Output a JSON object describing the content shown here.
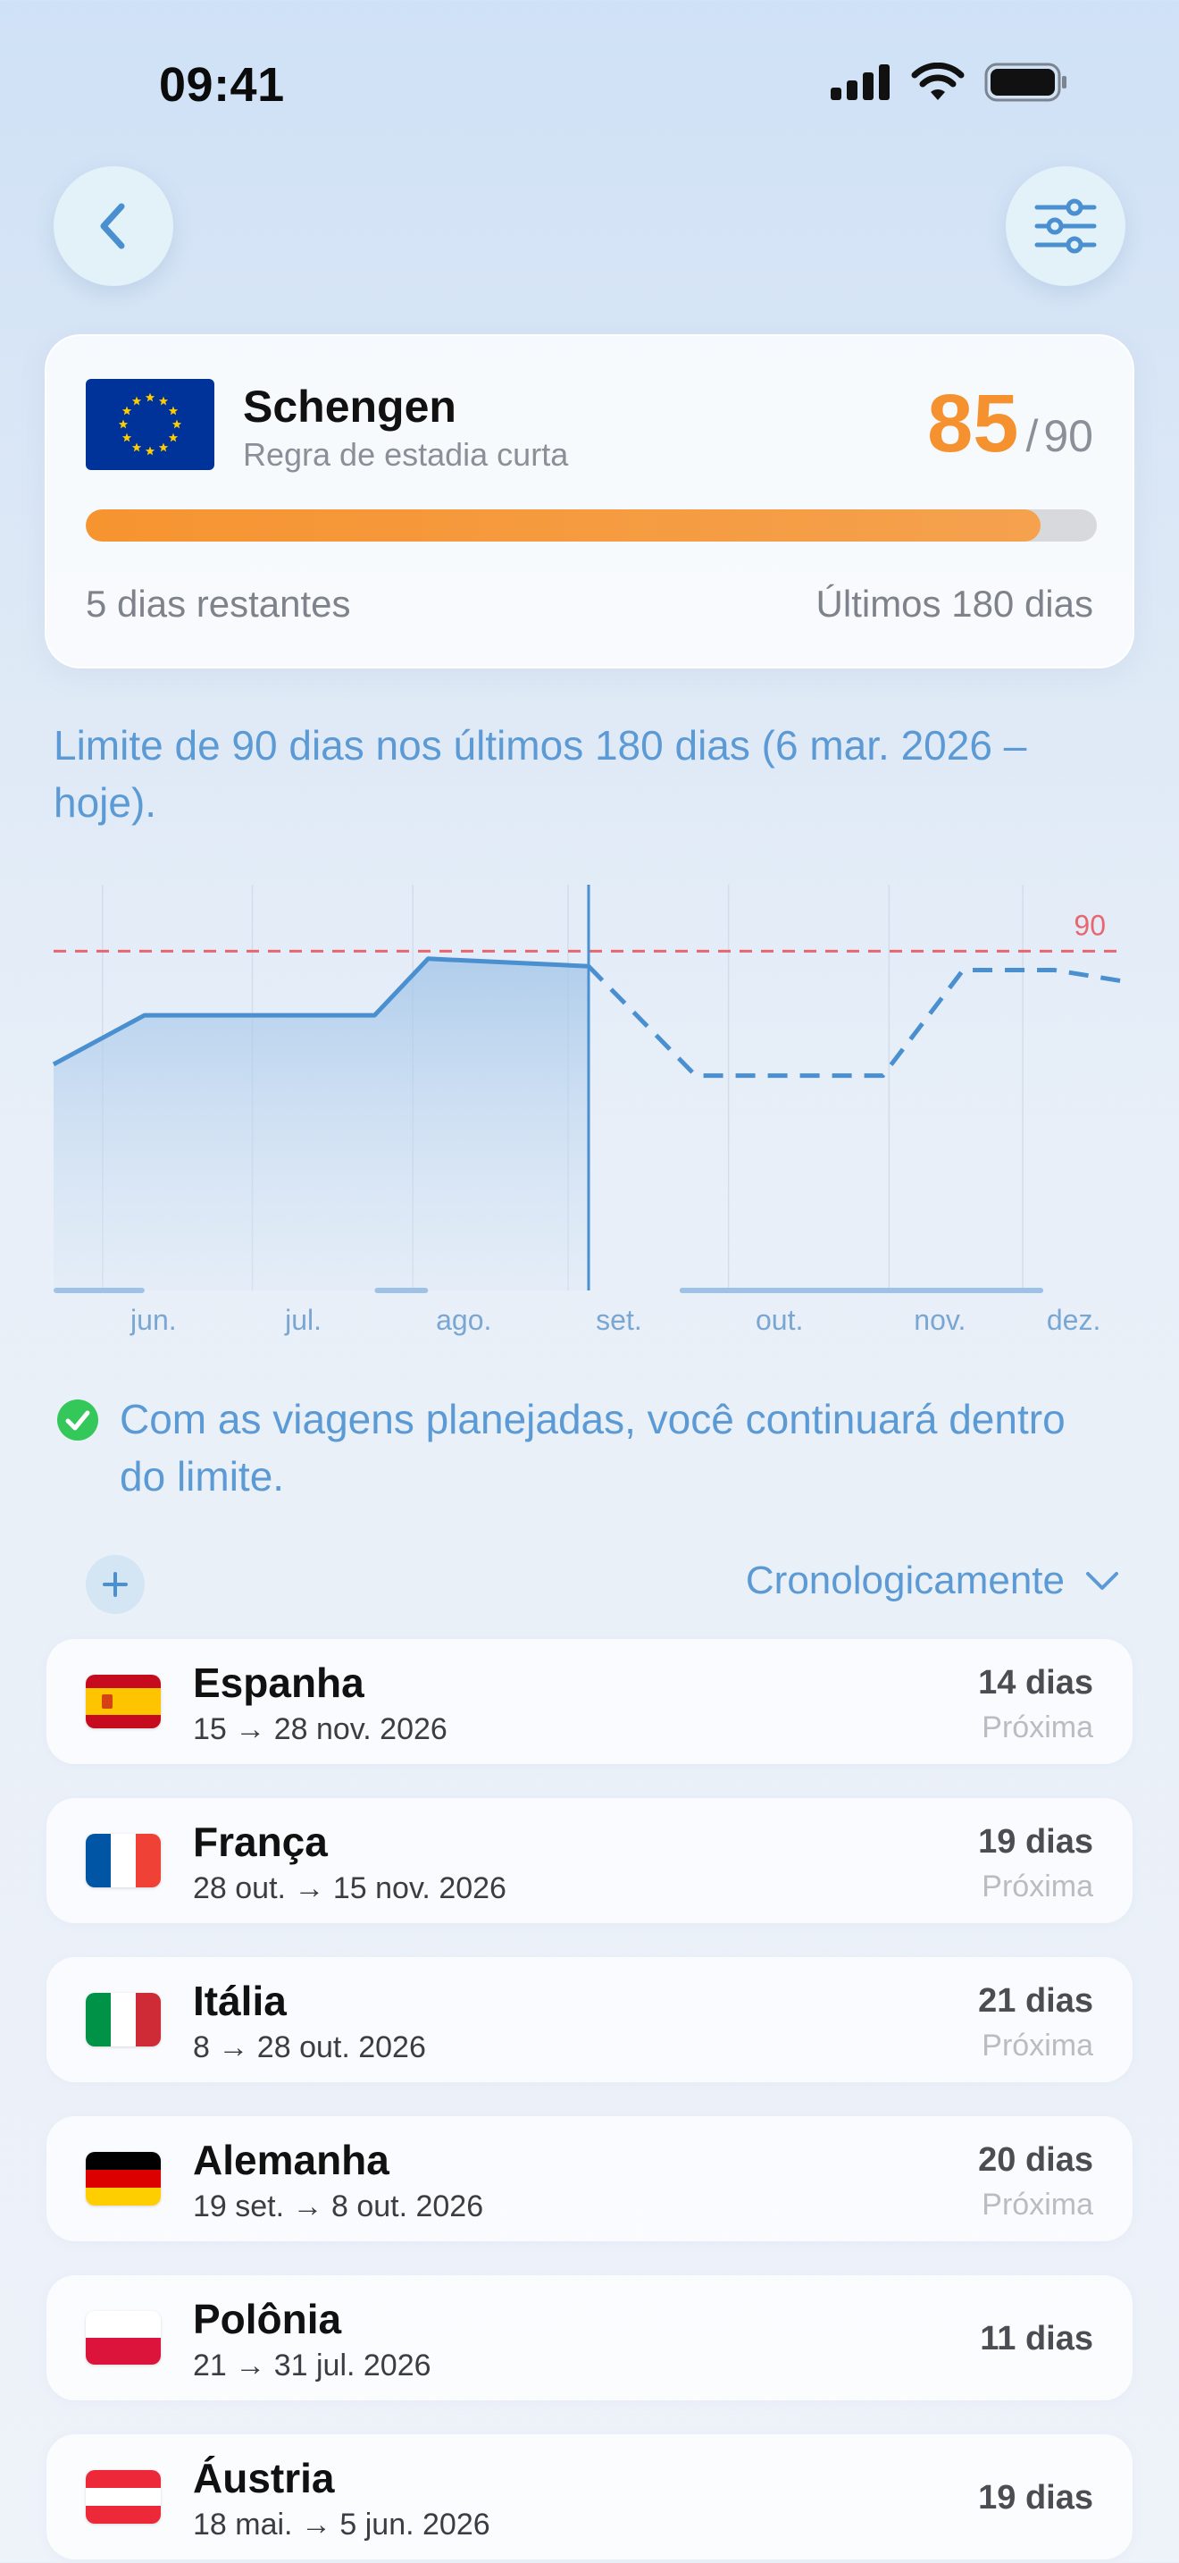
{
  "status_bar": {
    "time": "09:41"
  },
  "summary": {
    "region": "Schengen",
    "subtitle": "Regra de estadia curta",
    "used": "85",
    "slash": "/",
    "max": "90",
    "progress_fraction": 0.944,
    "remaining": "5 dias restantes",
    "window": "Últimos 180 dias"
  },
  "description": "Limite de 90 dias nos últimos 180 dias (6 mar. 2026 – hoje).",
  "chart_data": {
    "type": "area",
    "limit": 90,
    "limit_label": "90",
    "months": [
      "jun.",
      "jul.",
      "ago.",
      "set.",
      "out.",
      "nov.",
      "dez."
    ],
    "x_range": [
      0,
      200
    ],
    "y_range": [
      0,
      110
    ],
    "today_x": 100,
    "actual": {
      "x": [
        0,
        17,
        60,
        70,
        100
      ],
      "y": [
        60,
        73,
        73,
        88,
        86
      ]
    },
    "projected": {
      "x": [
        100,
        120,
        155,
        170,
        187,
        200
      ],
      "y": [
        86,
        57,
        57,
        85,
        85,
        82
      ]
    },
    "trip_bars": [
      {
        "start": 0,
        "end": 17
      },
      {
        "start": 60,
        "end": 70
      },
      {
        "start": 117,
        "end": 185
      }
    ]
  },
  "status_message": "Com as viagens planejadas, você continuará dentro do limite.",
  "toolbar": {
    "sort_label": "Cronologicamente"
  },
  "trips": [
    {
      "country": "Espanha",
      "dates": "15 → 28 nov. 2026",
      "days": "14 dias",
      "status": "Próxima",
      "flag": "es"
    },
    {
      "country": "França",
      "dates": "28 out. → 15 nov. 2026",
      "days": "19 dias",
      "status": "Próxima",
      "flag": "fr"
    },
    {
      "country": "Itália",
      "dates": "8 → 28 out. 2026",
      "days": "21 dias",
      "status": "Próxima",
      "flag": "it"
    },
    {
      "country": "Alemanha",
      "dates": "19 set. → 8 out. 2026",
      "days": "20 dias",
      "status": "Próxima",
      "flag": "de"
    },
    {
      "country": "Polônia",
      "dates": "21 → 31 jul. 2026",
      "days": "11 dias",
      "status": "",
      "flag": "pl"
    },
    {
      "country": "Áustria",
      "dates": "18 mai. → 5 jun. 2026",
      "days": "19 dias",
      "status": "",
      "flag": "at"
    }
  ],
  "colors": {
    "accent": "#5b9ad4",
    "orange": "#f5922f",
    "limit_line": "#e8666f",
    "success": "#34c759"
  }
}
